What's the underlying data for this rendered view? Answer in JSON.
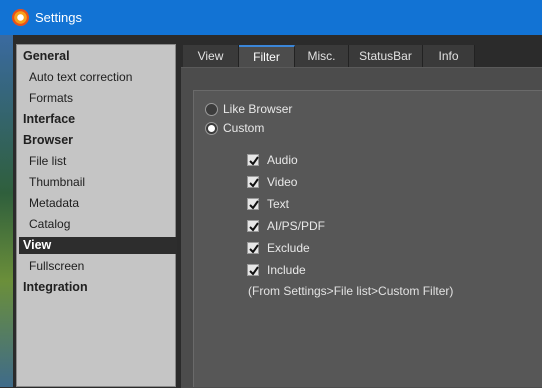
{
  "window": {
    "title": "Settings",
    "icon": "xnview-icon"
  },
  "sidebar": {
    "items": [
      {
        "label": "General",
        "type": "group",
        "selected": false
      },
      {
        "label": "Auto text correction",
        "type": "sub",
        "selected": false
      },
      {
        "label": "Formats",
        "type": "sub",
        "selected": false
      },
      {
        "label": "Interface",
        "type": "group",
        "selected": false
      },
      {
        "label": "Browser",
        "type": "group",
        "selected": false
      },
      {
        "label": "File list",
        "type": "sub",
        "selected": false
      },
      {
        "label": "Thumbnail",
        "type": "sub",
        "selected": false
      },
      {
        "label": "Metadata",
        "type": "sub",
        "selected": false
      },
      {
        "label": "Catalog",
        "type": "sub",
        "selected": false
      },
      {
        "label": "View",
        "type": "group",
        "selected": true
      },
      {
        "label": "Fullscreen",
        "type": "sub",
        "selected": false
      },
      {
        "label": "Integration",
        "type": "group",
        "selected": false
      }
    ]
  },
  "tabs": [
    {
      "label": "View",
      "active": false
    },
    {
      "label": "Filter",
      "active": true
    },
    {
      "label": "Misc.",
      "active": false
    },
    {
      "label": "StatusBar",
      "active": false
    },
    {
      "label": "Info",
      "active": false
    }
  ],
  "filter": {
    "mode_options": [
      {
        "label": "Like Browser",
        "selected": false
      },
      {
        "label": "Custom",
        "selected": true
      }
    ],
    "checkboxes": [
      {
        "label": "Audio",
        "checked": true
      },
      {
        "label": "Video",
        "checked": true
      },
      {
        "label": "Text",
        "checked": true
      },
      {
        "label": "AI/PS/PDF",
        "checked": true
      },
      {
        "label": "Exclude",
        "checked": true
      },
      {
        "label": "Include",
        "checked": true
      }
    ],
    "note": "(From Settings>File list>Custom Filter)"
  },
  "colors": {
    "titlebar": "#1273d4",
    "sidebar_bg": "#c5c5c5",
    "selected_bg": "#2d2d2d",
    "panel_bg": "#575757",
    "tab_accent": "#3b86d8"
  }
}
